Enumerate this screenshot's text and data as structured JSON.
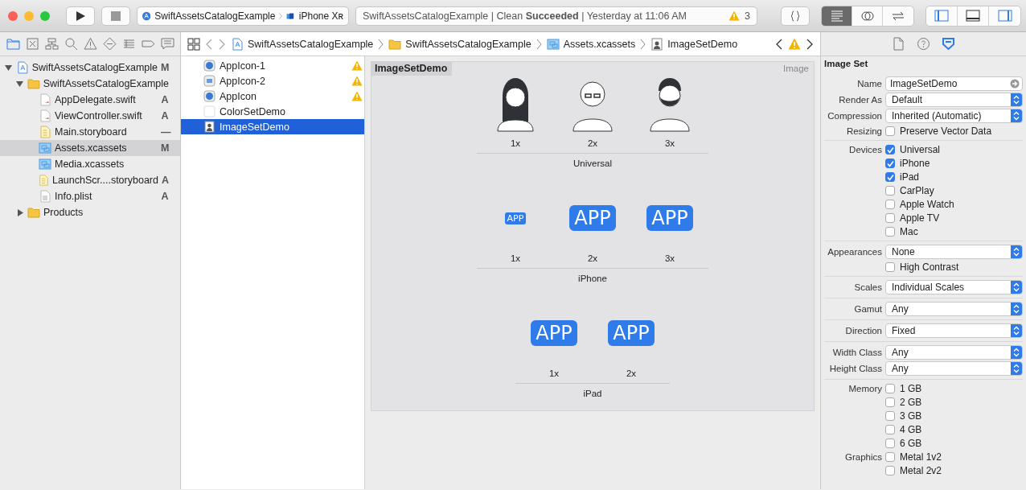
{
  "window": {
    "scheme": "SwiftAssetsCatalogExample",
    "device": "iPhone Xʀ",
    "activity": "SwiftAssetsCatalogExample | Clean **Succeeded** | Yesterday at 11:06 AM",
    "warning_count": "3",
    "editor_modes": [
      {
        "kind": "standard",
        "selected": true
      },
      {
        "kind": "assistant",
        "selected": false
      },
      {
        "kind": "version",
        "selected": false
      }
    ],
    "panels": [
      {
        "kind": "navigator",
        "selected": true
      },
      {
        "kind": "debug",
        "selected": false
      },
      {
        "kind": "inspector",
        "selected": true
      }
    ]
  },
  "navigator": {
    "tabs": [
      {
        "kind": "folder",
        "selected": true
      },
      {
        "kind": "source-control",
        "selected": false
      },
      {
        "kind": "hierarchy",
        "selected": false
      },
      {
        "kind": "search",
        "selected": false
      },
      {
        "kind": "issue",
        "selected": false
      },
      {
        "kind": "test",
        "selected": false
      },
      {
        "kind": "debug",
        "selected": false
      },
      {
        "kind": "breakpoint",
        "selected": false
      },
      {
        "kind": "report",
        "selected": false
      }
    ],
    "tree": [
      {
        "name": "SwiftAssetsCatalogExample",
        "kind": "project",
        "badge": "M",
        "selected": false,
        "expanded": true,
        "children": [
          {
            "name": "SwiftAssetsCatalogExample",
            "kind": "folder",
            "selected": false,
            "expanded": true,
            "children": [
              {
                "name": "AppDelegate.swift",
                "kind": "swift",
                "badge": "A",
                "selected": false
              },
              {
                "name": "ViewController.swift",
                "kind": "swift",
                "badge": "A",
                "selected": false
              },
              {
                "name": "Main.storyboard",
                "kind": "storyboard",
                "badge": "—",
                "selected": false
              },
              {
                "name": "Assets.xcassets",
                "kind": "xcassets",
                "badge": "M",
                "selected": true
              },
              {
                "name": "Media.xcassets",
                "kind": "xcassets",
                "selected": false
              },
              {
                "name": "LaunchScr....storyboard",
                "kind": "storyboard",
                "badge": "A",
                "selected": false
              },
              {
                "name": "Info.plist",
                "kind": "plist",
                "badge": "A",
                "selected": false
              }
            ]
          },
          {
            "name": "Products",
            "kind": "folder",
            "selected": false,
            "expanded": false
          }
        ]
      }
    ]
  },
  "jump_bar": [
    {
      "text": "SwiftAssetsCatalogExample",
      "kind": "project"
    },
    {
      "text": "SwiftAssetsCatalogExample",
      "kind": "folder"
    },
    {
      "text": "Assets.xcassets",
      "kind": "xcassets"
    },
    {
      "text": "ImageSetDemo",
      "kind": "image"
    }
  ],
  "assets": [
    {
      "name": "AppIcon-1",
      "kind": "appicon",
      "warning": true,
      "selected": false
    },
    {
      "name": "AppIcon-2",
      "kind": "appicon-alt",
      "warning": true,
      "selected": false
    },
    {
      "name": "AppIcon",
      "kind": "appicon",
      "warning": true,
      "selected": false
    },
    {
      "name": "ColorSetDemo",
      "kind": "color",
      "warning": false,
      "selected": false
    },
    {
      "name": "ImageSetDemo",
      "kind": "image",
      "warning": false,
      "selected": true
    }
  ],
  "editor": {
    "title": "ImageSetDemo",
    "type": "Image",
    "groups": [
      {
        "name": "Universal",
        "slots": [
          {
            "scale": "1x",
            "kind": "avatar-long-hair"
          },
          {
            "scale": "2x",
            "kind": "avatar-bald"
          },
          {
            "scale": "3x",
            "kind": "avatar-beard"
          }
        ]
      },
      {
        "name": "iPhone",
        "slots": [
          {
            "scale": "1x",
            "kind": "app-small",
            "label": "APP"
          },
          {
            "scale": "2x",
            "kind": "app",
            "label": "APP"
          },
          {
            "scale": "3x",
            "kind": "app",
            "label": "APP"
          }
        ]
      },
      {
        "name": "iPad",
        "slots": [
          {
            "scale": "1x",
            "kind": "app",
            "label": "APP"
          },
          {
            "scale": "2x",
            "kind": "app",
            "label": "APP"
          }
        ]
      }
    ]
  },
  "inspector": {
    "tabs": [
      {
        "kind": "file",
        "selected": false
      },
      {
        "kind": "help",
        "selected": false
      },
      {
        "kind": "attributes",
        "selected": true
      }
    ],
    "title": "Image Set",
    "sections": [
      [
        {
          "label": "Name",
          "kind": "field",
          "value": "ImageSetDemo"
        },
        {
          "label": "Render As",
          "kind": "popup",
          "value": "Default"
        },
        {
          "label": "Compression",
          "kind": "popup",
          "value": "Inherited (Automatic)"
        },
        {
          "label": "Resizing",
          "kind": "check",
          "text": "Preserve Vector Data",
          "checked": false
        }
      ],
      [
        {
          "label": "Devices",
          "kind": "check",
          "text": "Universal",
          "checked": true
        },
        {
          "kind": "check",
          "text": "iPhone",
          "checked": true
        },
        {
          "kind": "check",
          "text": "iPad",
          "checked": true
        },
        {
          "kind": "check",
          "text": "CarPlay",
          "checked": false
        },
        {
          "kind": "check",
          "text": "Apple Watch",
          "checked": false
        },
        {
          "kind": "check",
          "text": "Apple TV",
          "checked": false
        },
        {
          "kind": "check",
          "text": "Mac",
          "checked": false
        }
      ],
      [
        {
          "label": "Appearances",
          "kind": "popup",
          "value": "None"
        },
        {
          "kind": "check",
          "text": "High Contrast",
          "checked": false
        }
      ],
      [
        {
          "label": "Scales",
          "kind": "popup",
          "value": "Individual Scales"
        }
      ],
      [
        {
          "label": "Gamut",
          "kind": "popup",
          "value": "Any"
        }
      ],
      [
        {
          "label": "Direction",
          "kind": "popup",
          "value": "Fixed"
        }
      ],
      [
        {
          "label": "Width Class",
          "kind": "popup",
          "value": "Any"
        },
        {
          "label": "Height Class",
          "kind": "popup",
          "value": "Any"
        }
      ],
      [
        {
          "label": "Memory",
          "kind": "check",
          "text": "1 GB",
          "checked": false
        },
        {
          "kind": "check",
          "text": "2 GB",
          "checked": false
        },
        {
          "kind": "check",
          "text": "3 GB",
          "checked": false
        },
        {
          "kind": "check",
          "text": "4 GB",
          "checked": false
        },
        {
          "kind": "check",
          "text": "6 GB",
          "checked": false
        },
        {
          "label": "Graphics",
          "kind": "check",
          "text": "Metal 1v2",
          "checked": false
        },
        {
          "kind": "check",
          "text": "Metal 2v2",
          "checked": false
        }
      ]
    ]
  }
}
